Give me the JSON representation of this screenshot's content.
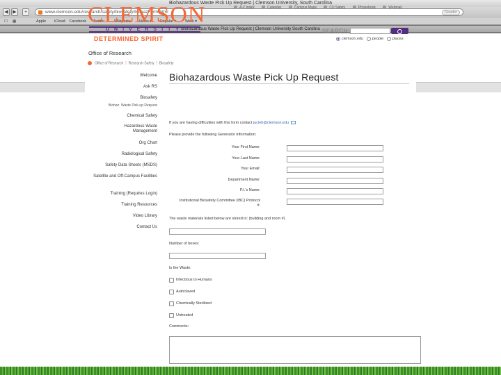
{
  "browser": {
    "window_title": "Biohazardous Waste Pick Up Request | Clemson University, South Carolina",
    "url_domain": "www.clemson.edu",
    "url_path": "/research/safety/biosafety/biohazForm.html",
    "reader_label": "Reader",
    "back": "◀",
    "forward": "▶",
    "add": "+",
    "tab_title": "Biohazardous Waste Pick Up Request | Clemson University South Carolina",
    "bookmarks": [
      "Apple",
      "iCloud",
      "Facebook",
      "Twitter",
      "Wikipedia",
      "News ▾",
      "Popular ▾",
      "Work ▾"
    ],
    "bookmark_icons": [
      "book-icon",
      "grid-icon"
    ]
  },
  "header": {
    "logo_main": "CLEMSON",
    "logo_sub": "UNIVERSITY",
    "tagline": "DETERMINED SPIRIT",
    "top_links": [
      "A-Z Index",
      "Calendar",
      "Campus Maps",
      "CU Safety",
      "Phonebook",
      "Webmail"
    ],
    "search_label": "SEARCH:",
    "search_scopes": [
      "clemson.edu",
      "people",
      "places"
    ],
    "selected_scope": "clemson.edu"
  },
  "band": {
    "title": "Office of Research"
  },
  "breadcrumb": [
    "Office of Research",
    "Research Safety",
    "Biosafety"
  ],
  "leftnav": [
    "Welcome",
    "Ask RS",
    "Biosafety",
    "Biohaz. Waste Pick-up Request",
    "Chemical Safety",
    "Hazardous Waste Management",
    "Org Chart",
    "Radiological Safety",
    "Safety Data Sheets (MSDS)",
    "Satellite and Off-Campus Facilities",
    "Training (Requires Login)",
    "Training Resources",
    "Video Library",
    "Contact Us"
  ],
  "form": {
    "title": "Biohazardous Waste Pick Up Request",
    "contact_text": "If you are having difficulties with this form contact ",
    "contact_email": "jucieh@clemson.edu",
    "generator_intro": "Please provide the following Generator Information:",
    "fields": [
      "Your First Name:",
      "Your Last Name:",
      "Your Email:",
      "Department Name:",
      "P.I.'s Name:",
      "Institutional Biosafety Committee (IBC) Protocol #:"
    ],
    "location_label": "The waste materials listed below are stored in: (building and room #)",
    "boxes_label": "Number of boxes:",
    "waste_question": "Is the Waste:",
    "waste_options": [
      "Infectious to Humans",
      "Autoclaved",
      "Chemically Sterilized",
      "Untreated"
    ],
    "comments_label": "Comments:"
  }
}
